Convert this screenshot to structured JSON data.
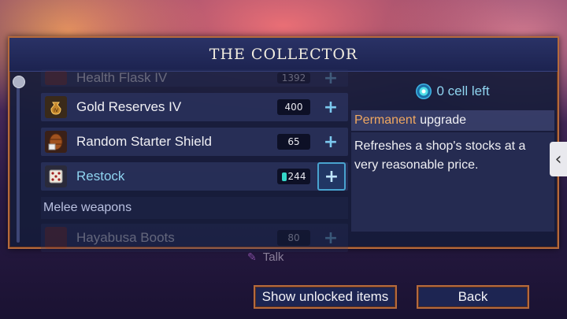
{
  "title": "THE COLLECTOR",
  "list": {
    "partial_item": {
      "label": "Health Flask IV",
      "price": "1392"
    },
    "items": [
      {
        "label": "Gold Reserves IV",
        "price": "400",
        "icon": "gold-bag-icon"
      },
      {
        "label": "Random Starter Shield",
        "price": "65",
        "icon": "shield-barrel-icon"
      },
      {
        "label": "Restock",
        "price": "244",
        "icon": "dice-icon",
        "selected": true
      }
    ],
    "category": "Melee weapons",
    "next_item": {
      "label": "Hayabusa Boots",
      "price": "80"
    }
  },
  "detail": {
    "cells_left": "0 cell left",
    "kind": "Permanent",
    "kind_suffix": "upgrade",
    "description": "Refreshes a shop's stocks at a very reasonable price."
  },
  "side_tab": "‹",
  "talk": "Talk",
  "buttons": {
    "show_unlocked": "Show unlocked items",
    "back": "Back"
  },
  "colors": {
    "frame": "#b56a3c",
    "panel": "#161c3a",
    "accent_blue": "#8fd4f0",
    "orange": "#f0a860",
    "cell_teal": "#35d7c9"
  }
}
